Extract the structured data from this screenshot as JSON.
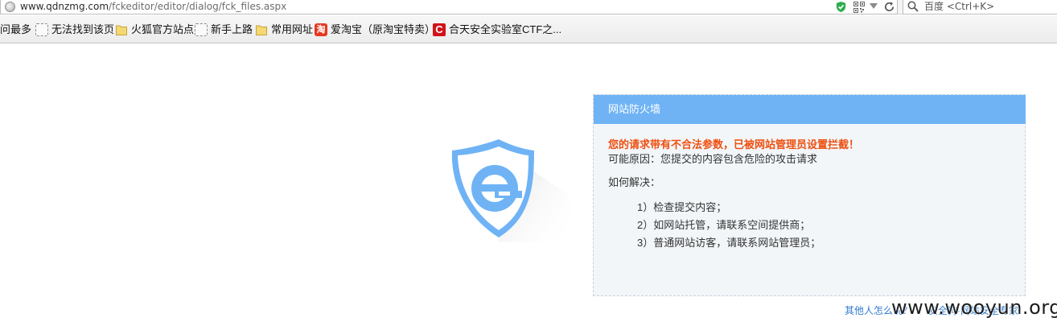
{
  "browser": {
    "url_host": "www.qdnzmg.com",
    "url_path": "/fckeditor/editor/dialog/fck_files.aspx",
    "search_placeholder": "百度 <Ctrl+K>"
  },
  "bookmarks": [
    {
      "label": "问最多",
      "icon": "none"
    },
    {
      "label": "无法找到该页",
      "icon": "dashed-page-icon"
    },
    {
      "label": "火狐官方站点",
      "icon": "folder-icon"
    },
    {
      "label": "新手上路",
      "icon": "dashed-page-icon"
    },
    {
      "label": "常用网址",
      "icon": "folder-icon"
    },
    {
      "label": "爱淘宝（原淘宝特卖）",
      "icon": "taobao-icon"
    },
    {
      "label": "合天安全实验室CTF之...",
      "icon": "hetian-c-icon"
    }
  ],
  "firewall": {
    "title": "网站防火墙",
    "warning": "您的请求带有不合法参数，已被网站管理员设置拦截！",
    "reason": "可能原因：您提交的内容包含危险的攻击请求",
    "solution_heading": "如何解决：",
    "steps": [
      "1）检查提交内容；",
      "2）如网站托管，请联系空间提供商；",
      "3）普通网站访客，请联系网站管理员；"
    ],
    "footer_links": [
      "其他人怎么说？",
      "安全狗·网站安全专家"
    ]
  },
  "colors": {
    "header_blue": "#6fb3f5",
    "warning_orange": "#ef4f10",
    "link_blue": "#2f7bd1",
    "logo_blue": "#6fb3f5"
  },
  "watermark": "www.wooyun.org"
}
